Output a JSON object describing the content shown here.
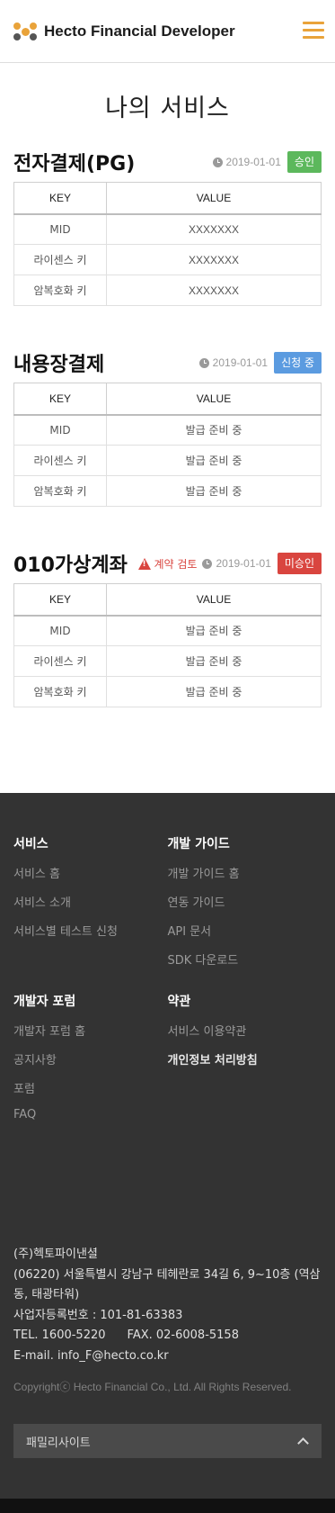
{
  "header": {
    "logo_text": "Hecto Financial Developer",
    "menu_icon": "hamburger-icon",
    "accent_color": "#e9a33a"
  },
  "page_title": "나의 서비스",
  "table_headers": {
    "key": "KEY",
    "value": "VALUE"
  },
  "services": [
    {
      "title": "전자결제(PG)",
      "warning": null,
      "date": "2019-01-01",
      "status": "승인",
      "status_color": "#5cb85c",
      "rows": [
        {
          "key": "MID",
          "value": "XXXXXXX"
        },
        {
          "key": "라이센스 키",
          "value": "XXXXXXX"
        },
        {
          "key": "암복호화 키",
          "value": "XXXXXXX"
        }
      ]
    },
    {
      "title": "내용장결제",
      "warning": null,
      "date": "2019-01-01",
      "status": "신청 중",
      "status_color": "#5b9be0",
      "rows": [
        {
          "key": "MID",
          "value": "발급 준비 중"
        },
        {
          "key": "라이센스 키",
          "value": "발급 준비 중"
        },
        {
          "key": "암복호화 키",
          "value": "발급 준비 중"
        }
      ]
    },
    {
      "title": "010가상계좌",
      "warning": "계약 검토",
      "date": "2019-01-01",
      "status": "미승인",
      "status_color": "#d9453f",
      "rows": [
        {
          "key": "MID",
          "value": "발급 준비 중"
        },
        {
          "key": "라이센스 키",
          "value": "발급 준비 중"
        },
        {
          "key": "암복호화 키",
          "value": "발급 준비 중"
        }
      ]
    }
  ],
  "footer": {
    "sections": {
      "service": {
        "title": "서비스",
        "items": [
          "서비스 홈",
          "서비스 소개",
          "서비스별 테스트 신청"
        ]
      },
      "guide": {
        "title": "개발 가이드",
        "items": [
          "개발 가이드 홈",
          "연동 가이드",
          "API 문서",
          "SDK 다운로드"
        ]
      },
      "forum": {
        "title": "개발자 포럼",
        "items": [
          "개발자 포럼 홈",
          "공지사항",
          "포럼",
          "FAQ"
        ]
      },
      "terms": {
        "title": "약관",
        "items": [
          "서비스 이용약관",
          "개인정보 처리방침"
        ]
      }
    },
    "company": {
      "name": "(주)헥토파이낸셜",
      "address": "(06220) 서울특별시 강남구 테헤란로 34길 6, 9~10층 (역삼동, 태광타워)",
      "biz_no": "사업자등록번호 : 101-81-63383",
      "tel": "TEL. 1600-5220",
      "fax": "FAX. 02-6008-5158",
      "email": "E-mail. info_F@hecto.co.kr"
    },
    "copyright": "Copyrightⓒ Hecto Financial Co., Ltd. All Rights Reserved.",
    "family_site": "패밀리사이트"
  }
}
